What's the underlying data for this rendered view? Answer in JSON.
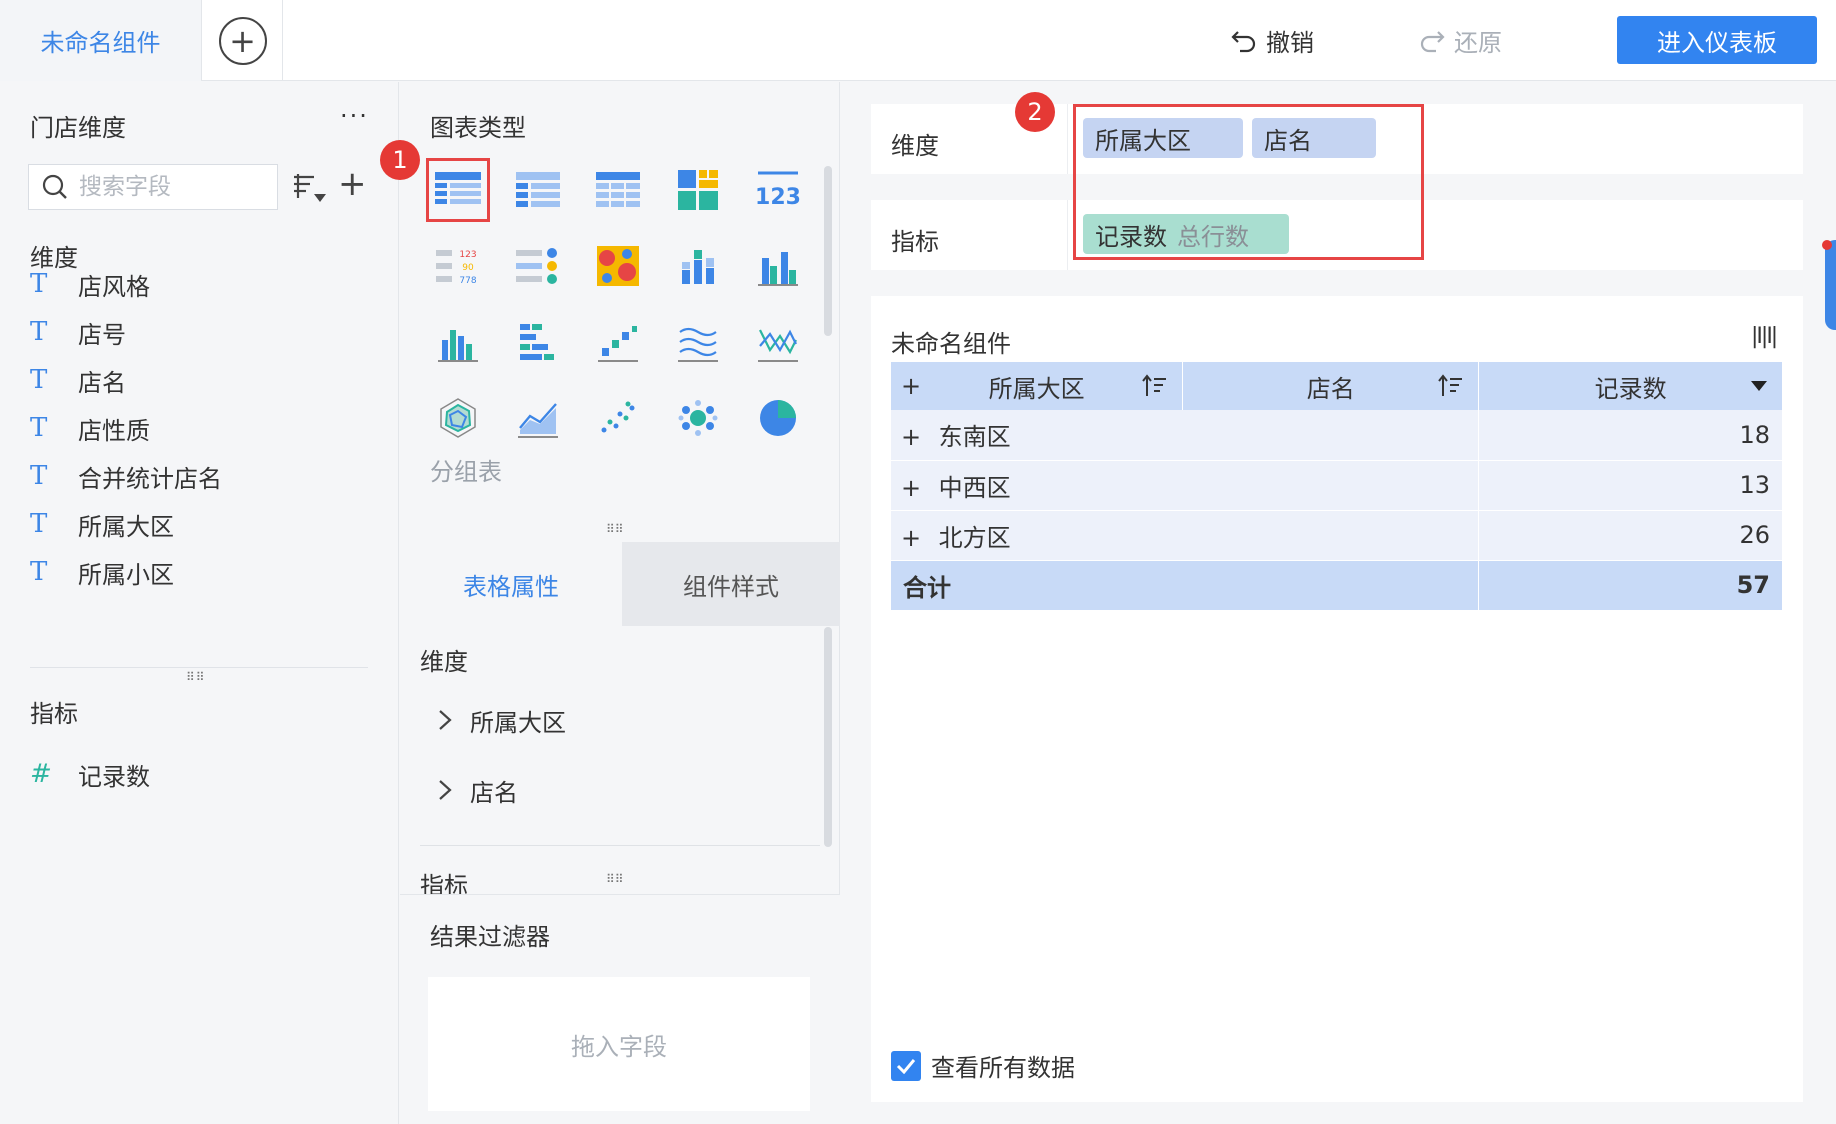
{
  "top": {
    "tab_label": "未命名组件",
    "undo_label": "撤销",
    "redo_label": "还原",
    "enter_dashboard_label": "进入仪表板"
  },
  "left": {
    "title": "门店维度",
    "more": "···",
    "search_placeholder": "搜索字段",
    "dimension_heading": "维度",
    "dimension_fields": [
      "店风格",
      "店号",
      "店名",
      "店性质",
      "合并统计店名",
      "所属大区",
      "所属小区"
    ],
    "metric_heading": "指标",
    "metric_fields": [
      "记录数"
    ]
  },
  "middle": {
    "chart_type_title": "图表类型",
    "chart_label": "分组表",
    "tabs": [
      "表格属性",
      "组件样式"
    ],
    "props_dimension_heading": "维度",
    "props_dimension_items": [
      "所属大区",
      "店名"
    ],
    "props_metric_heading": "指标",
    "filter_title": "结果过滤器",
    "drop_zone_text": "拖入字段"
  },
  "right": {
    "dimension_label": "维度",
    "dimension_pills": [
      "所属大区",
      "店名"
    ],
    "metric_label": "指标",
    "metric_pill": {
      "name": "记录数",
      "sub": "总行数"
    },
    "badges": [
      "1",
      "2"
    ],
    "widget_title": "未命名组件",
    "table": {
      "columns": [
        "所属大区",
        "店名",
        "记录数"
      ],
      "rows": [
        {
          "region": "东南区",
          "value": "18"
        },
        {
          "region": "中西区",
          "value": "13"
        },
        {
          "region": "北方区",
          "value": "26"
        }
      ],
      "total_label": "合计",
      "total_value": "57"
    },
    "view_all_label": "查看所有数据"
  },
  "colors": {
    "accent": "#3284f0",
    "highlight_red": "#e64545",
    "dim_pill": "#c5d4f2",
    "metric_pill": "#a9ded0"
  }
}
